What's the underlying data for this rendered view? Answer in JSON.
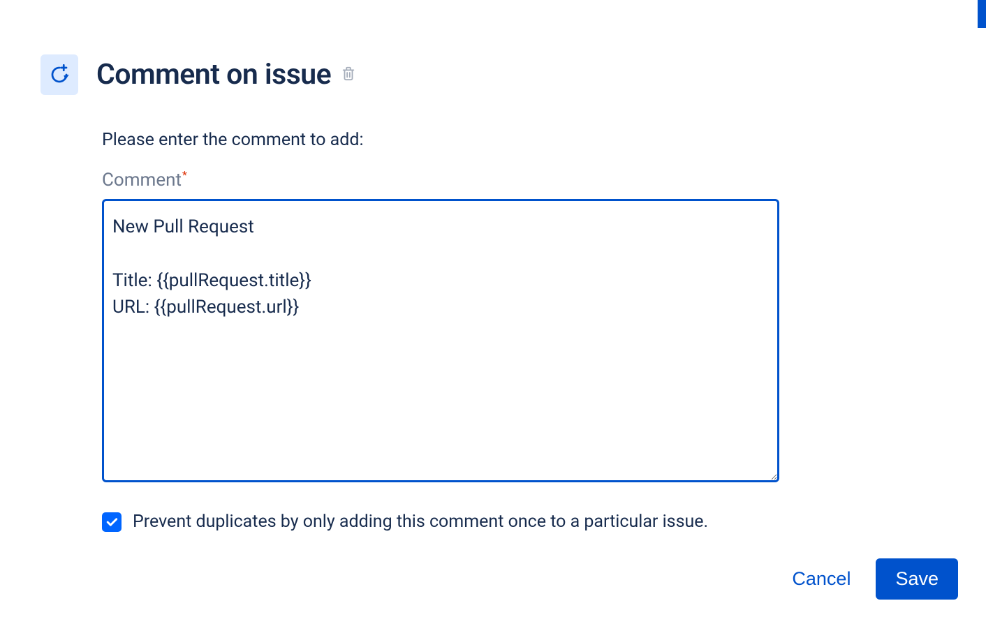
{
  "header": {
    "title": "Comment on issue"
  },
  "prompt": "Please enter the comment to add:",
  "field": {
    "label": "Comment",
    "value": "New Pull Request\n\nTitle: {{pullRequest.title}}\nURL: {{pullRequest.url}}"
  },
  "checkbox": {
    "checked": true,
    "label": "Prevent duplicates by only adding this comment once to a particular issue."
  },
  "buttons": {
    "cancel": "Cancel",
    "save": "Save"
  }
}
